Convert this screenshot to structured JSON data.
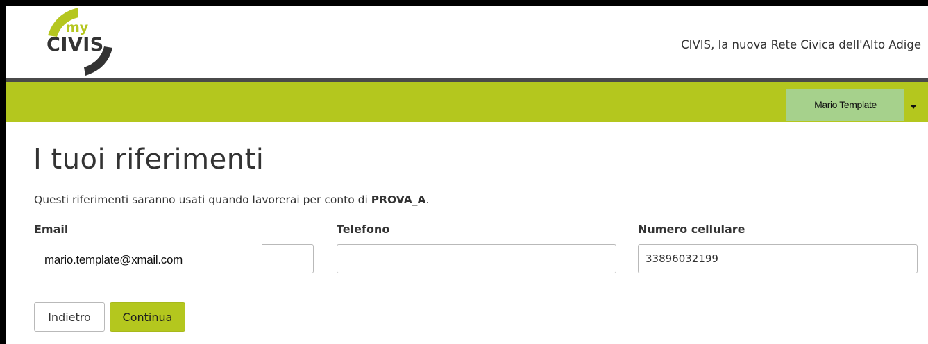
{
  "header": {
    "logo": {
      "my": "my",
      "civis": "CIVIS"
    },
    "tagline": "CIVIS, la nuova Rete Civica dell'Alto Adige"
  },
  "nav": {
    "user_name": "Mario Template"
  },
  "main": {
    "title": "I tuoi riferimenti",
    "intro_text": "Questi riferimenti saranno usati quando lavorerai per conto di ",
    "intro_org": "PROVA_A",
    "intro_end": ".",
    "fields": [
      {
        "label": "Email",
        "value": "mario.template@xmail.com"
      },
      {
        "label": "Telefono",
        "value": ""
      },
      {
        "label": "Numero cellulare",
        "value": "33896032199"
      }
    ],
    "buttons": {
      "back": "Indietro",
      "continue": "Continua"
    }
  },
  "colors": {
    "brand_green": "#b4c71e",
    "user_menu": "#a6d18c",
    "dark": "#4a4a4a"
  }
}
